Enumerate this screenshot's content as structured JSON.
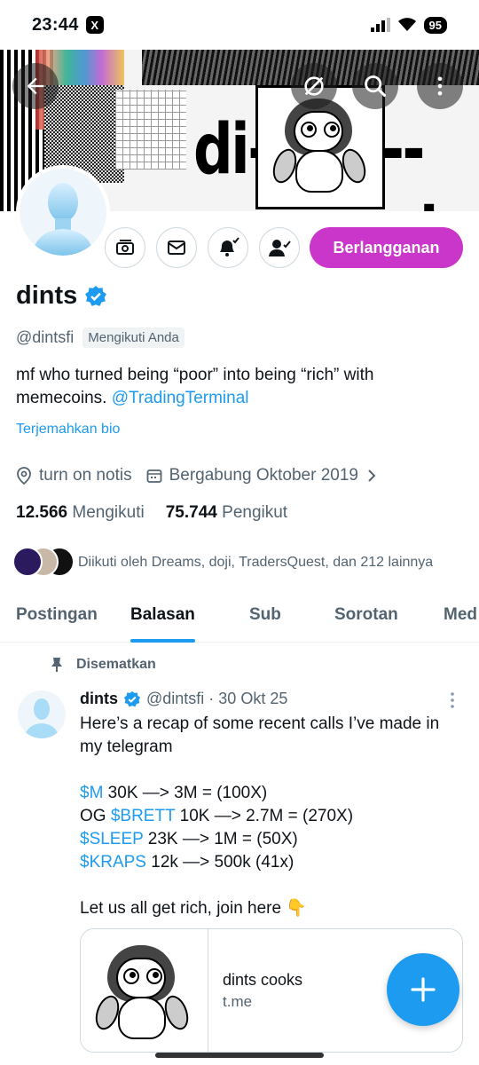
{
  "status_bar": {
    "time": "23:44",
    "app_icon": "x-logo-icon",
    "battery": "95"
  },
  "banner": {
    "text_left": "di--",
    "text_right": "--nts"
  },
  "profile": {
    "name": "dints",
    "handle": "@dintsfi",
    "follows_you": "Mengikuti Anda",
    "subscribe_label": "Berlangganan",
    "bio_text": "mf who turned being “poor” into being “rich” with memecoins. ",
    "bio_link": "@TradingTerminal",
    "translate_bio": "Terjemahkan bio",
    "location": "turn on notis",
    "joined": "Bergabung Oktober 2019",
    "following_count": "12.566",
    "following_label": "Mengikuti",
    "followers_count": "75.744",
    "followers_label": "Pengikut",
    "followed_by": "Diikuti oleh Dreams, doji, TradersQuest, dan 212 lainnya"
  },
  "tabs": [
    {
      "label": "Postingan"
    },
    {
      "label": "Balasan"
    },
    {
      "label": "Sub"
    },
    {
      "label": "Sorotan"
    },
    {
      "label": "Med"
    }
  ],
  "pinned_post": {
    "pinned_label": "Disematkan",
    "author_name": "dints",
    "meta": "@dintsfi · 30 Okt 25",
    "line1": "Here’s a recap of some recent calls I’ve made in",
    "line2": "my telegram",
    "calls": [
      {
        "prefix": "",
        "tag": "$M",
        "rest": " 30K —> 3M = (100X)"
      },
      {
        "prefix": "OG ",
        "tag": "$BRETT",
        "rest": " 10K —> 2.7M = (270X)"
      },
      {
        "prefix": "",
        "tag": "$SLEEP",
        "rest": " 23K —> 1M = (50X)"
      },
      {
        "prefix": "",
        "tag": "$KRAPS",
        "rest": " 12k —> 500k (41x)"
      }
    ],
    "closing": "Let us all get rich, join here 👇",
    "card_title": "dints cooks",
    "card_domain": "t.me"
  },
  "colors": {
    "accent": "#1d9bf0",
    "subscribe": "#c936c9",
    "muted": "#536471"
  }
}
